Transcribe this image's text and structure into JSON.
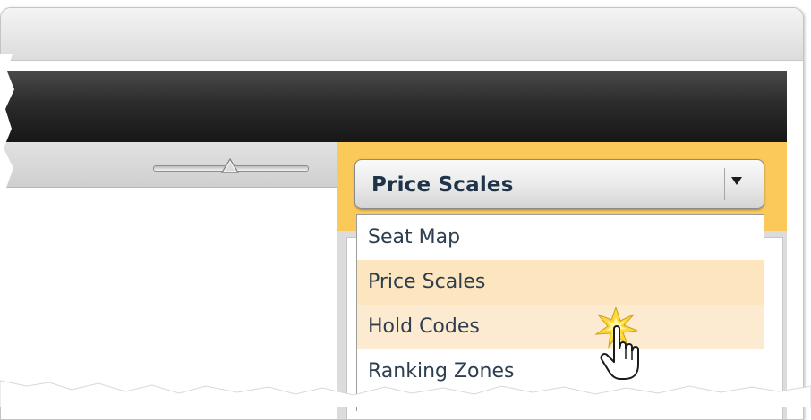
{
  "dropdown": {
    "selected": "Price Scales",
    "arrow_icon": "triangle-down-icon",
    "options": [
      "Seat Map",
      "Price Scales",
      "Hold Codes",
      "Ranking Zones"
    ],
    "selected_index": 1,
    "hover_index": 2
  },
  "slider": {
    "thumb_icon": "slider-thumb-icon"
  },
  "colors": {
    "accent_orange": "#fbc85a",
    "header_dark": "#232423",
    "label_text": "#1f3349",
    "menu_selected_bg": "#fde5c0",
    "menu_hover_bg": "#fdebd1"
  },
  "cursor": {
    "icon": "hand-pointer-icon",
    "effect": "click-burst"
  }
}
